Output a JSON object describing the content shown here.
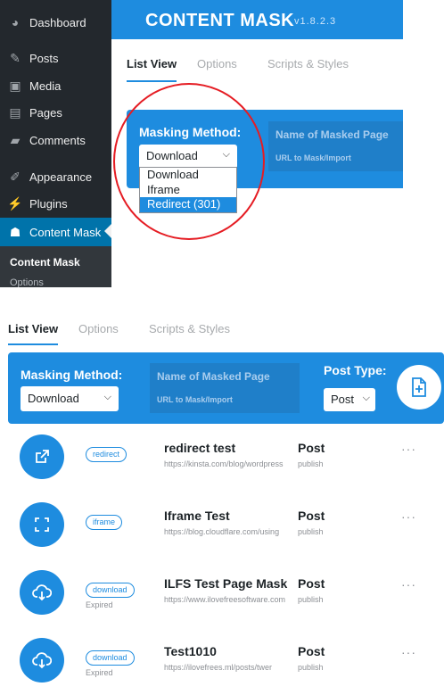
{
  "wp_menu": [
    {
      "label": "Dashboard",
      "icon": "dashboard-icon",
      "glyph": "◕"
    },
    {
      "label": "Posts",
      "icon": "pin-icon",
      "glyph": "✎"
    },
    {
      "label": "Media",
      "icon": "media-icon",
      "glyph": "▣"
    },
    {
      "label": "Pages",
      "icon": "pages-icon",
      "glyph": "▤"
    },
    {
      "label": "Comments",
      "icon": "comment-icon",
      "glyph": "▰"
    },
    {
      "label": "Appearance",
      "icon": "brush-icon",
      "glyph": "✐"
    },
    {
      "label": "Plugins",
      "icon": "plug-icon",
      "glyph": "⚡"
    },
    {
      "label": "Content Mask",
      "icon": "mask-icon",
      "glyph": "☗"
    }
  ],
  "wp_submenu": {
    "current": "Content Mask",
    "next": "Options"
  },
  "header": {
    "title": "CONTENT MASK",
    "version": "v1.8.2.3"
  },
  "tabs": [
    "List View",
    "Options",
    "Scripts & Styles"
  ],
  "masking": {
    "label": "Masking Method:",
    "selected": "Download",
    "options": [
      "Download",
      "Iframe",
      "Redirect (301)"
    ],
    "highlighted": "Redirect (301)",
    "name_placeholder": "Name of Masked Page",
    "url_placeholder": "URL to Mask/Import"
  },
  "post_type": {
    "label": "Post Type:",
    "selected": "Post"
  },
  "rows": [
    {
      "method": "redirect",
      "icon": "external-link-icon",
      "expired": "",
      "title": "redirect test",
      "url": "https://kinsta.com/blog/wordpress",
      "type": "Post",
      "status": "publish"
    },
    {
      "method": "iframe",
      "icon": "expand-icon",
      "expired": "",
      "title": "Iframe Test",
      "url": "https://blog.cloudflare.com/using",
      "type": "Post",
      "status": "publish"
    },
    {
      "method": "download",
      "icon": "cloud-download-icon",
      "expired": "Expired",
      "title": "ILFS Test Page Mask",
      "url": "https://www.ilovefreesoftware.com",
      "type": "Post",
      "status": "publish"
    },
    {
      "method": "download",
      "icon": "cloud-download-icon",
      "expired": "Expired",
      "title": "Test1010",
      "url": "https://ilovefrees.ml/posts/twer",
      "type": "Post",
      "status": "publish"
    }
  ],
  "more_glyph": "···",
  "colors": {
    "accent": "#1e8cdf",
    "sidebar": "#23282d",
    "annotation": "#e51c23"
  }
}
